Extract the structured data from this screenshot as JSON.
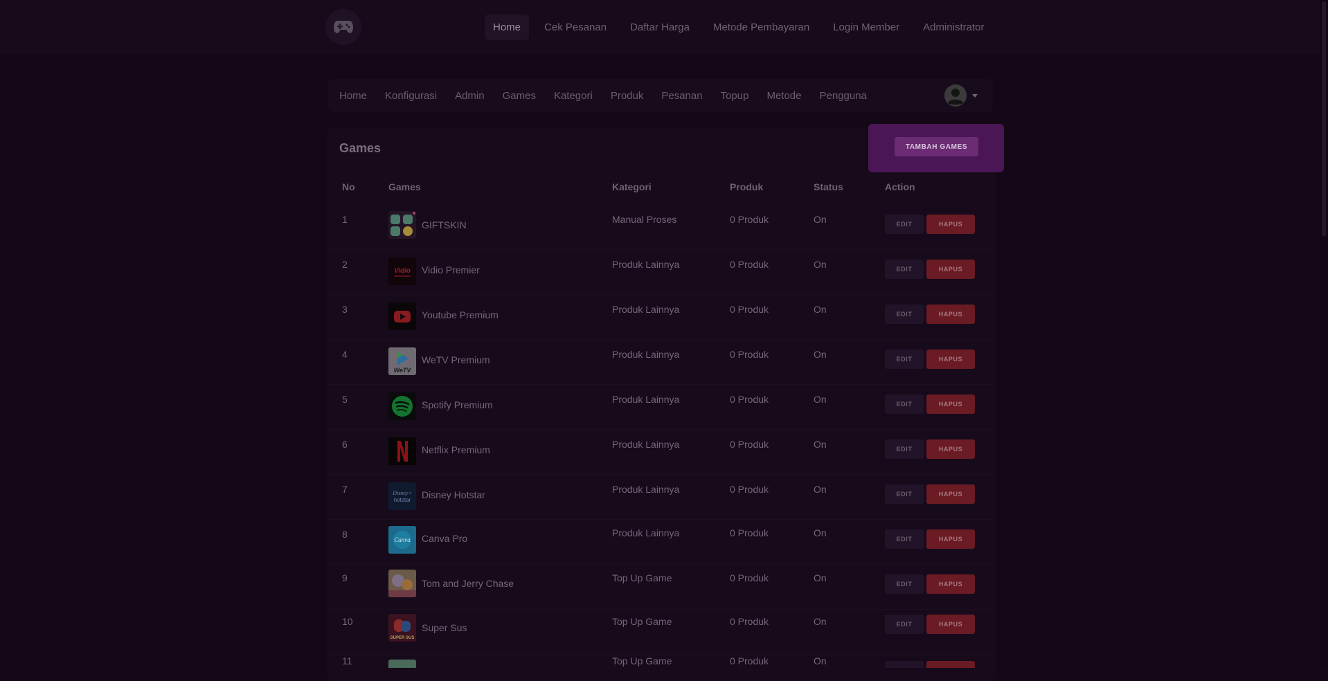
{
  "topnav": {
    "items": [
      {
        "label": "Home"
      },
      {
        "label": "Cek Pesanan"
      },
      {
        "label": "Daftar Harga"
      },
      {
        "label": "Metode Pembayaran"
      },
      {
        "label": "Login Member"
      },
      {
        "label": "Administrator"
      }
    ],
    "active": "Home"
  },
  "subnav": {
    "items": [
      {
        "label": "Home"
      },
      {
        "label": "Konfigurasi"
      },
      {
        "label": "Admin"
      },
      {
        "label": "Games"
      },
      {
        "label": "Kategori"
      },
      {
        "label": "Produk"
      },
      {
        "label": "Pesanan"
      },
      {
        "label": "Topup"
      },
      {
        "label": "Metode"
      },
      {
        "label": "Pengguna"
      }
    ]
  },
  "page": {
    "title": "Games",
    "add_button": "TAMBAH GAMES"
  },
  "table": {
    "headers": {
      "no": "No",
      "games": "Games",
      "kategori": "Kategori",
      "produk": "Produk",
      "status": "Status",
      "action": "Action"
    },
    "edit_label": "EDIT",
    "delete_label": "HAPUS",
    "rows": [
      {
        "no": "1",
        "name": "GIFTSKIN",
        "kategori": "Manual Proses",
        "produk": "0 Produk",
        "status": "On",
        "icon": "giftskin-icon"
      },
      {
        "no": "2",
        "name": "Vidio Premier",
        "kategori": "Produk Lainnya",
        "produk": "0 Produk",
        "status": "On",
        "icon": "vidio-icon"
      },
      {
        "no": "3",
        "name": "Youtube Premium",
        "kategori": "Produk Lainnya",
        "produk": "0 Produk",
        "status": "On",
        "icon": "youtube-icon"
      },
      {
        "no": "4",
        "name": "WeTV Premium",
        "kategori": "Produk Lainnya",
        "produk": "0 Produk",
        "status": "On",
        "icon": "wetv-icon"
      },
      {
        "no": "5",
        "name": "Spotify Premium",
        "kategori": "Produk Lainnya",
        "produk": "0 Produk",
        "status": "On",
        "icon": "spotify-icon"
      },
      {
        "no": "6",
        "name": "Netflix Premium",
        "kategori": "Produk Lainnya",
        "produk": "0 Produk",
        "status": "On",
        "icon": "netflix-icon"
      },
      {
        "no": "7",
        "name": "Disney Hotstar",
        "kategori": "Produk Lainnya",
        "produk": "0 Produk",
        "status": "On",
        "icon": "disney-hotstar-icon"
      },
      {
        "no": "8",
        "name": "Canva Pro",
        "kategori": "Produk Lainnya",
        "produk": "0 Produk",
        "status": "On",
        "icon": "canva-icon"
      },
      {
        "no": "9",
        "name": "Tom and Jerry Chase",
        "kategori": "Top Up Game",
        "produk": "0 Produk",
        "status": "On",
        "icon": "tom-jerry-icon"
      },
      {
        "no": "10",
        "name": "Super Sus",
        "kategori": "Top Up Game",
        "produk": "0 Produk",
        "status": "On",
        "icon": "super-sus-icon"
      },
      {
        "no": "11",
        "name": "",
        "kategori": "Top Up Game",
        "produk": "0 Produk",
        "status": "On",
        "icon": "game-icon"
      }
    ]
  },
  "colors": {
    "accent": "#6b2c74",
    "danger": "#6a1b24",
    "background": "#140716"
  }
}
